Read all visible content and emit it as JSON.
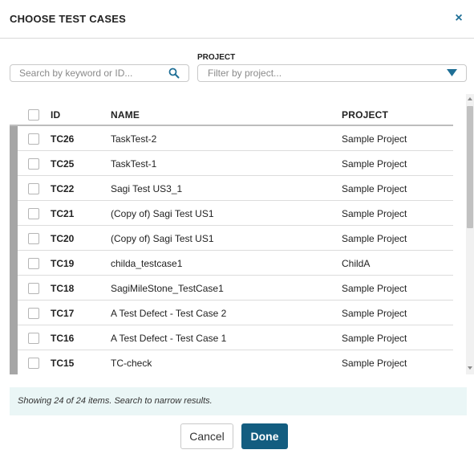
{
  "dialog": {
    "title": "CHOOSE TEST CASES",
    "close_glyph": "×"
  },
  "search": {
    "placeholder": "Search by keyword or ID...",
    "icon": "search-icon"
  },
  "project_filter": {
    "label": "PROJECT",
    "placeholder": "Filter by project...",
    "icon": "caret-down-icon"
  },
  "table": {
    "columns": {
      "id": "ID",
      "name": "NAME",
      "project": "PROJECT"
    },
    "rows": [
      {
        "id": "TC26",
        "name": "TaskTest-2",
        "project": "Sample Project"
      },
      {
        "id": "TC25",
        "name": "TaskTest-1",
        "project": "Sample Project"
      },
      {
        "id": "TC22",
        "name": "Sagi Test US3_1",
        "project": "Sample Project"
      },
      {
        "id": "TC21",
        "name": "(Copy of) Sagi Test US1",
        "project": "Sample Project"
      },
      {
        "id": "TC20",
        "name": "(Copy of) Sagi Test US1",
        "project": "Sample Project"
      },
      {
        "id": "TC19",
        "name": "childa_testcase1",
        "project": "ChildA"
      },
      {
        "id": "TC18",
        "name": "SagiMileStone_TestCase1",
        "project": "Sample Project"
      },
      {
        "id": "TC17",
        "name": "A Test Defect - Test Case 2",
        "project": "Sample Project"
      },
      {
        "id": "TC16",
        "name": "A Test Defect - Test Case 1",
        "project": "Sample Project"
      },
      {
        "id": "TC15",
        "name": "TC-check",
        "project": "Sample Project"
      }
    ]
  },
  "status": {
    "text": "Showing 24 of 24 items. Search to narrow results."
  },
  "footer": {
    "cancel_label": "Cancel",
    "done_label": "Done"
  },
  "colors": {
    "accent": "#135d80",
    "close": "#1f6f96",
    "row_marker": "#a6a6a6",
    "status_bg": "#eaf6f6"
  }
}
